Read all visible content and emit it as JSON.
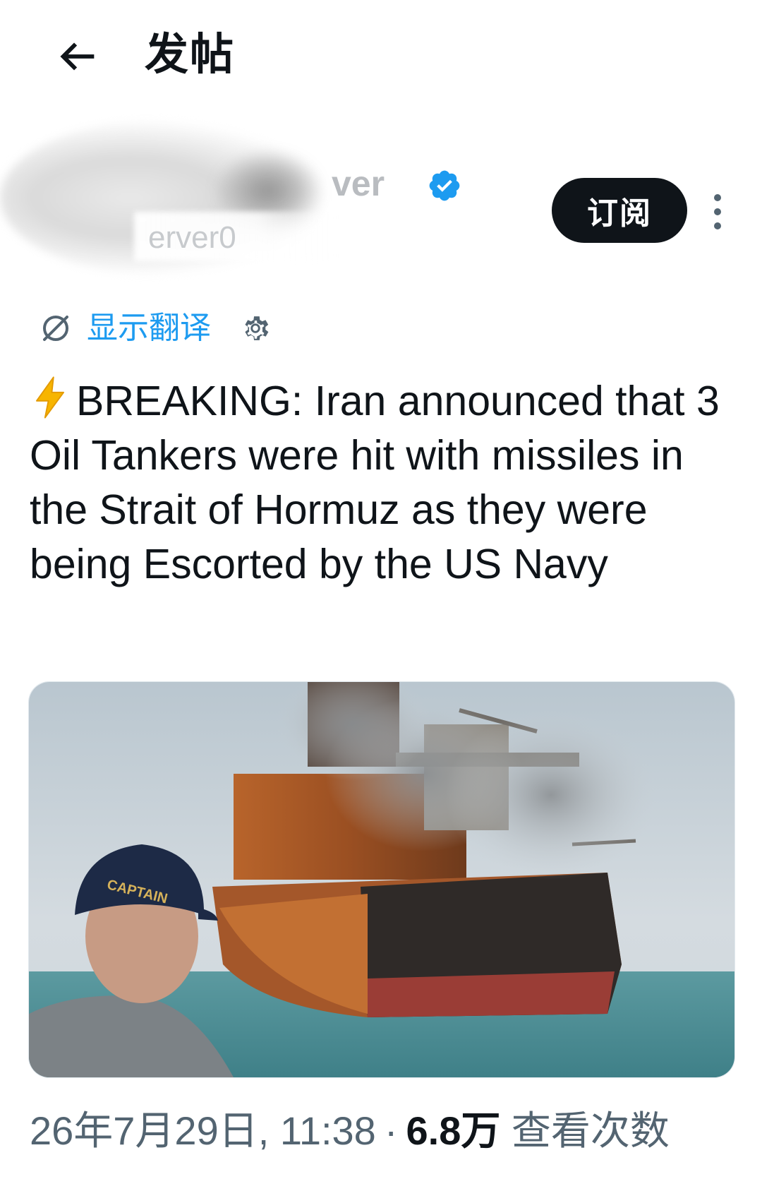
{
  "header": {
    "title": "发帖"
  },
  "author": {
    "display_name": "ver",
    "handle": "erver0",
    "subscribe_label": "订阅"
  },
  "translate": {
    "label": "显示翻译"
  },
  "post": {
    "text": "BREAKING: Iran announced that 3 Oil Tankers were hit with missiles in the Strait of Hormuz as they were being Escorted by the US Navy",
    "image_cap_text": "CAPTAIN"
  },
  "meta": {
    "timestamp": "26年7月29日, 11:38",
    "separator": "·",
    "views_count": "6.8万",
    "views_label": "查看次数"
  },
  "colors": {
    "accent": "#1d9bf0",
    "text_primary": "#0f1419",
    "text_secondary": "#536471",
    "button_bg": "#0f1419"
  },
  "icons": {
    "back": "back-arrow-icon",
    "verified": "verified-badge-icon",
    "more": "more-vertical-icon",
    "translate": "translate-slash-icon",
    "settings": "gear-icon",
    "lightning": "lightning-bolt-icon"
  }
}
